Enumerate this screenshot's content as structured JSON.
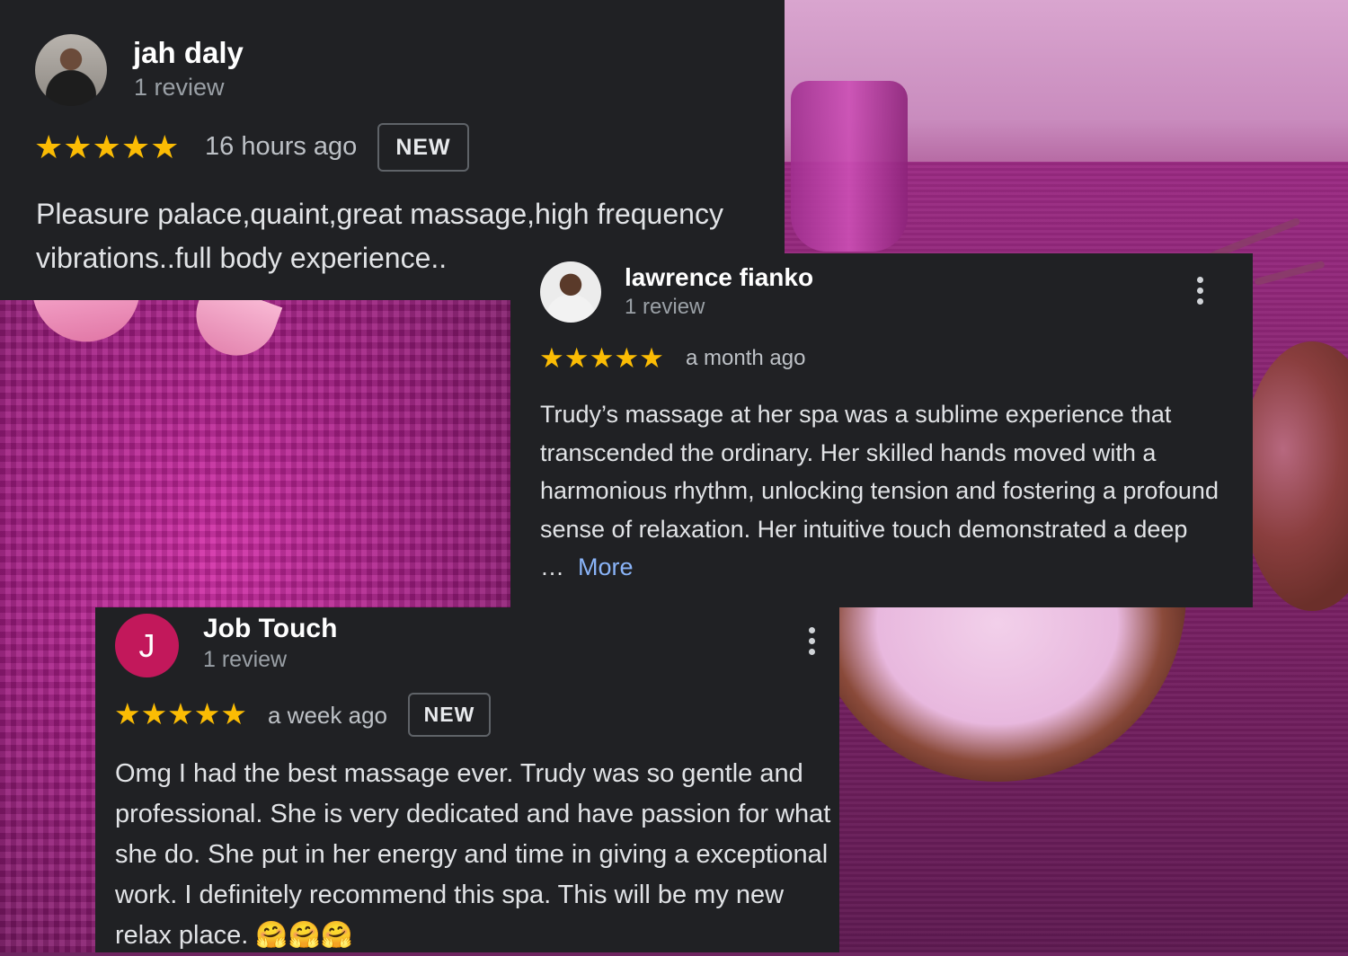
{
  "colors": {
    "card_background": "#202124",
    "star": "#fbbc04",
    "link": "#8ab4f8",
    "avatar_j": "#c2185b"
  },
  "reviews": [
    {
      "author": "jah daly",
      "review_count": "1 review",
      "rating": 5,
      "stars": "★★★★★",
      "time": "16 hours ago",
      "badge": "NEW",
      "text": "Pleasure palace,quaint,great massage,high frequency vibrations..full body experience.."
    },
    {
      "author": "lawrence fianko",
      "review_count": "1 review",
      "rating": 5,
      "stars": "★★★★★",
      "time": "a month ago",
      "text": "Trudy’s massage at her spa was a sublime experience that transcended the ordinary. Her skilled hands moved with a harmonious rhythm, unlocking tension and fostering a profound sense of relaxation. Her intuitive touch demonstrated a deep …",
      "more_label": "More",
      "menu_icon": "more-vert-icon"
    },
    {
      "author": "Job Touch",
      "avatar_letter": "J",
      "review_count": "1 review",
      "rating": 5,
      "stars": "★★★★★",
      "time": "a week ago",
      "badge": "NEW",
      "text": "Omg I had the best massage ever. Trudy was so gentle and professional. She is very dedicated and have passion for what she do. She put in her energy and time in giving a exceptional work. I definitely recommend this spa. This will be my new relax place. 🤗🤗🤗",
      "menu_icon": "more-vert-icon"
    }
  ]
}
